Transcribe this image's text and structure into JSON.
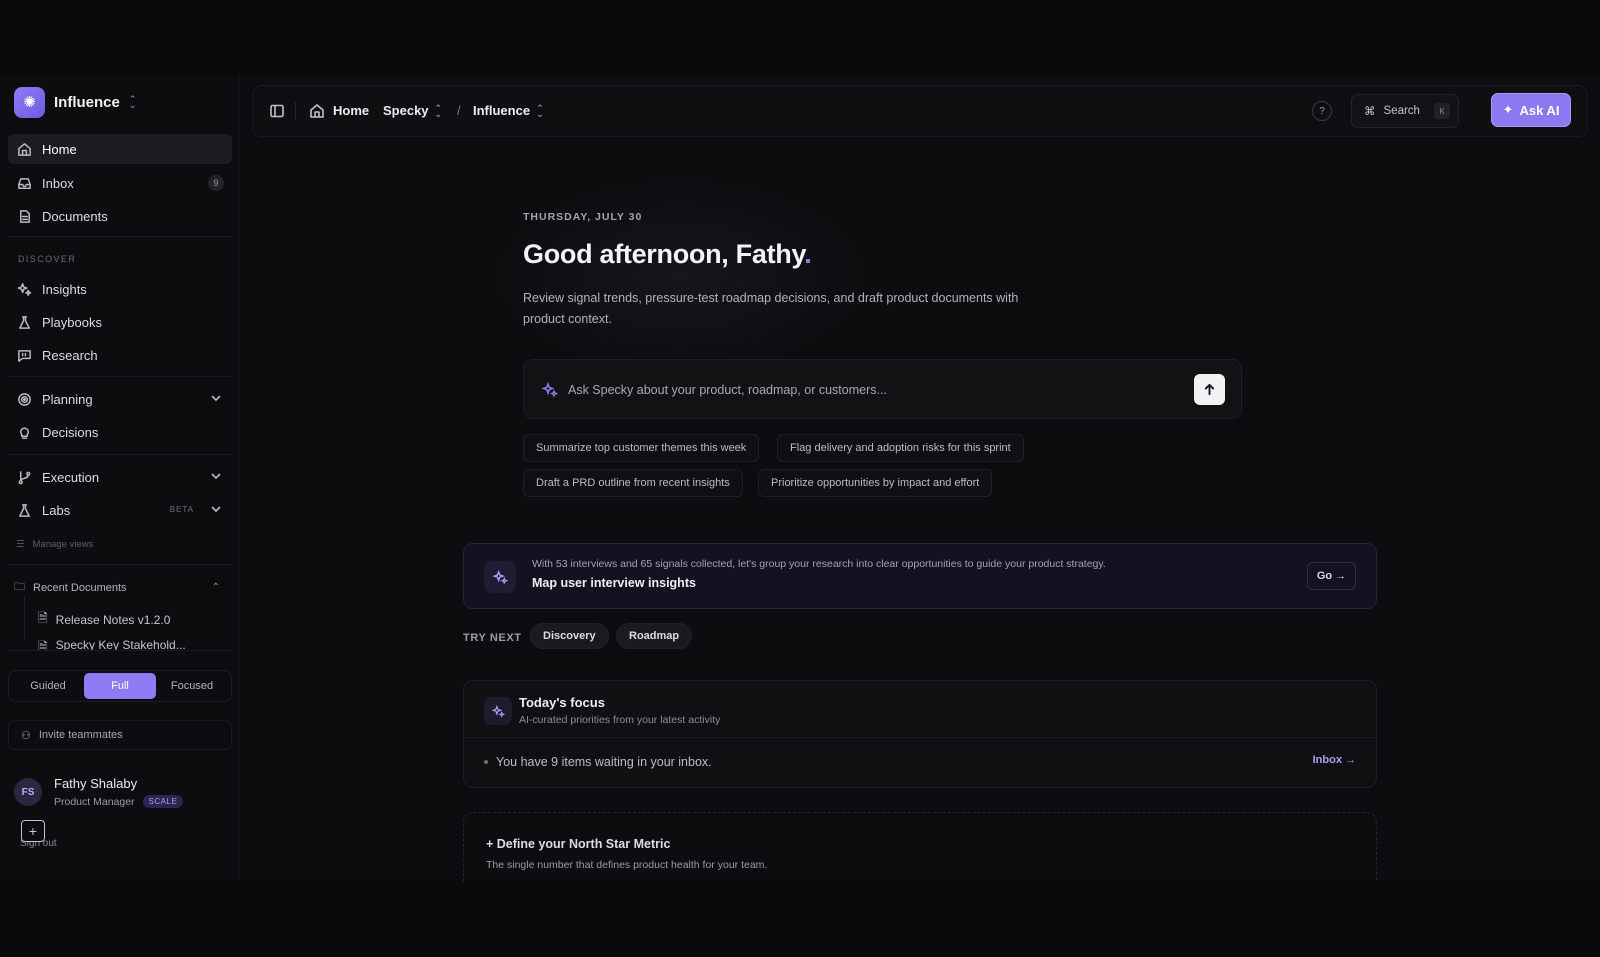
{
  "workspace": {
    "name": "Influence"
  },
  "nav": {
    "home": "Home",
    "inbox": "Inbox",
    "inbox_count": "9",
    "documents": "Documents",
    "discover_label": "DISCOVER",
    "insights": "Insights",
    "playbooks": "Playbooks",
    "research": "Research",
    "planning": "Planning",
    "decisions": "Decisions",
    "execution": "Execution",
    "labs": "Labs",
    "labs_badge": "BETA",
    "manage_views": "Manage views"
  },
  "recent": {
    "title": "Recent Documents",
    "items": [
      "Release Notes v1.2.0",
      "Specky Key Stakehold..."
    ]
  },
  "modes": {
    "guided": "Guided",
    "full": "Full",
    "focused": "Focused",
    "active": "Full"
  },
  "invite": "Invite teammates",
  "user": {
    "initials": "FS",
    "name": "Fathy Shalaby",
    "role": "Product Manager",
    "plan": "SCALE",
    "sign_out": "Sign out"
  },
  "topbar": {
    "home": "Home",
    "product": "Specky",
    "separator": "/",
    "workspace": "Influence",
    "help": "?",
    "search": "Search",
    "search_key": "K",
    "ask_ai": "Ask AI"
  },
  "main": {
    "date": "THURSDAY, JULY 30",
    "greeting": "Good afternoon, Fathy",
    "greeting_dot": ".",
    "subtitle": "Review signal trends, pressure-test roadmap decisions, and draft product documents with product context.",
    "ask_placeholder": "Ask Specky about your product, roadmap, or customers...",
    "suggestions": [
      "Summarize top customer themes this week",
      "Flag delivery and adoption risks for this sprint",
      "Draft a PRD outline from recent insights",
      "Prioritize opportunities by impact and effort"
    ],
    "banner": {
      "text": "With 53 interviews and 65 signals collected, let's group your research into clear opportunities to guide your product strategy.",
      "title": "Map user interview insights",
      "button": "Go →"
    },
    "try_next": {
      "label": "TRY NEXT",
      "pills": [
        "Discovery",
        "Roadmap"
      ]
    },
    "focus": {
      "title": "Today's focus",
      "subtitle": "AI-curated priorities from your latest activity",
      "item": "You have 9 items waiting in your inbox.",
      "link": "Inbox →"
    },
    "north_star": {
      "title": "+ Define your North Star Metric",
      "subtitle": "The single number that defines product health for your team."
    }
  },
  "colors": {
    "accent": "#8b79f1",
    "background": "#0d0d10"
  }
}
